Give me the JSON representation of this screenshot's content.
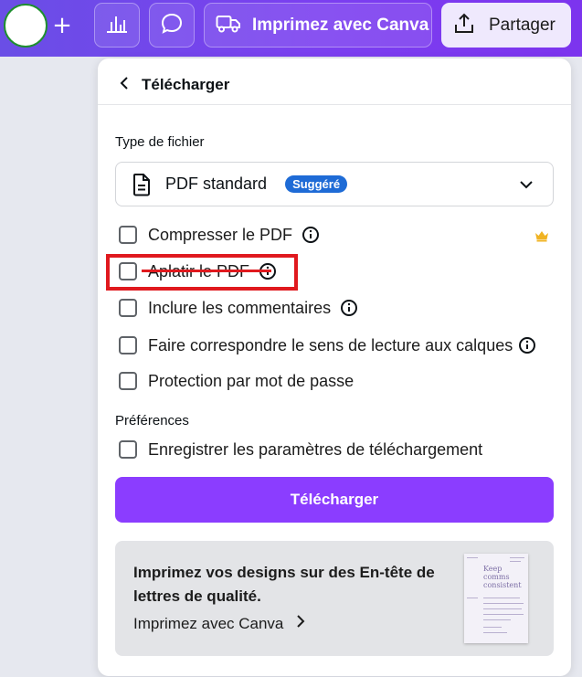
{
  "topbar": {
    "print_label": "Imprimez avec Canva",
    "share_label": "Partager"
  },
  "panel": {
    "title": "Télécharger",
    "file_type_label": "Type de fichier",
    "file_type_value": "PDF standard",
    "file_type_badge": "Suggéré",
    "options": [
      {
        "label": "Compresser le PDF",
        "checked": false,
        "info": true,
        "premium": true
      },
      {
        "label": "Aplatir le PDF",
        "checked": false,
        "info": true,
        "premium": false
      },
      {
        "label": "Inclure les commentaires",
        "checked": false,
        "info": true,
        "premium": false
      },
      {
        "label": "Faire correspondre le sens de lecture aux calques",
        "checked": false,
        "info": true,
        "premium": false
      },
      {
        "label": "Protection par mot de passe",
        "checked": false,
        "info": false,
        "premium": false
      }
    ],
    "preferences_label": "Préférences",
    "save_settings_label": "Enregistrer les paramètres de téléchargement",
    "download_button": "Télécharger",
    "promo": {
      "headline": "Imprimez vos designs sur des En-tête de lettres de qualité.",
      "link": "Imprimez avec Canva",
      "thumbnail_text": "Keep comms consistent"
    }
  },
  "colors": {
    "accent": "#8b3dff",
    "badge": "#1e6bd6",
    "annotation": "#e0191e",
    "crown": "#f0b323"
  },
  "icons": [
    "plus-icon",
    "stats-icon",
    "comment-icon",
    "truck-icon",
    "share-upload-icon",
    "back-chevron-icon",
    "document-icon",
    "chevron-down-icon",
    "info-icon",
    "crown-icon",
    "chevron-right-icon"
  ]
}
